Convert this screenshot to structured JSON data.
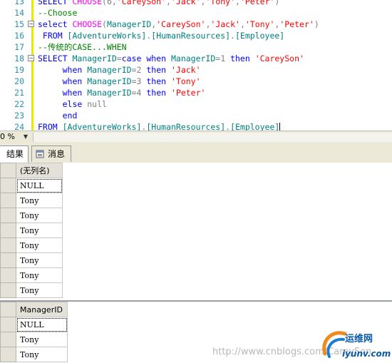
{
  "editor": {
    "lines": [
      {
        "num": "13",
        "parts": [
          [
            "kw",
            "SELECT "
          ],
          [
            "fn",
            "CHOOSE"
          ],
          [
            "gr",
            "(6,"
          ],
          [
            "str",
            "'CareySon'"
          ],
          [
            "gr",
            ","
          ],
          [
            "str",
            "'Jack'"
          ],
          [
            "gr",
            ","
          ],
          [
            "str",
            "'Tony'"
          ],
          [
            "gr",
            ","
          ],
          [
            "str",
            "'Peter'"
          ],
          [
            "gr",
            ")"
          ]
        ]
      },
      {
        "num": "14",
        "parts": [
          [
            "cm",
            "--Choose"
          ]
        ]
      },
      {
        "num": "15",
        "fold": "−",
        "parts": [
          [
            "kw",
            "select "
          ],
          [
            "fn",
            "CHOOSE"
          ],
          [
            "gr",
            "("
          ],
          [
            "tx",
            "ManagerID"
          ],
          [
            "gr",
            ","
          ],
          [
            "str",
            "'CareySon'"
          ],
          [
            "gr",
            ","
          ],
          [
            "str",
            "'Jack'"
          ],
          [
            "gr",
            ","
          ],
          [
            "str",
            "'Tony'"
          ],
          [
            "gr",
            ","
          ],
          [
            "str",
            "'Peter'"
          ],
          [
            "gr",
            ")"
          ]
        ]
      },
      {
        "num": "16",
        "parts": [
          [
            "kw",
            " FROM "
          ],
          [
            "tx",
            "[AdventureWorks]"
          ],
          [
            "gr",
            "."
          ],
          [
            "tx",
            "[HumanResources]"
          ],
          [
            "gr",
            "."
          ],
          [
            "tx",
            "[Employee]"
          ]
        ]
      },
      {
        "num": "17",
        "parts": [
          [
            "cm",
            "--传统的CASE...WHEN"
          ]
        ]
      },
      {
        "num": "18",
        "fold": "−",
        "parts": [
          [
            "kw",
            "SELECT "
          ],
          [
            "tx",
            "ManagerID"
          ],
          [
            "gr",
            "="
          ],
          [
            "kw",
            "case when "
          ],
          [
            "tx",
            "ManagerID"
          ],
          [
            "gr",
            "=1 "
          ],
          [
            "kw",
            "then "
          ],
          [
            "str",
            "'CareySon'"
          ]
        ]
      },
      {
        "num": "19",
        "parts": [
          [
            "kw",
            "     when "
          ],
          [
            "tx",
            "ManagerID"
          ],
          [
            "gr",
            "=2 "
          ],
          [
            "kw",
            "then "
          ],
          [
            "str",
            "'Jack'"
          ]
        ]
      },
      {
        "num": "20",
        "parts": [
          [
            "kw",
            "     when "
          ],
          [
            "tx",
            "ManagerID"
          ],
          [
            "gr",
            "=3 "
          ],
          [
            "kw",
            "then "
          ],
          [
            "str",
            "'Tony'"
          ]
        ]
      },
      {
        "num": "21",
        "parts": [
          [
            "kw",
            "     when "
          ],
          [
            "tx",
            "ManagerID"
          ],
          [
            "gr",
            "=4 "
          ],
          [
            "kw",
            "then "
          ],
          [
            "str",
            "'Peter'"
          ]
        ]
      },
      {
        "num": "22",
        "parts": [
          [
            "kw",
            "     else "
          ],
          [
            "gr",
            "null"
          ]
        ]
      },
      {
        "num": "23",
        "parts": [
          [
            "kw",
            "     end"
          ]
        ]
      },
      {
        "num": "24",
        "caret": true,
        "parts": [
          [
            "kw",
            "FROM "
          ],
          [
            "tx",
            "[AdventureWorks]"
          ],
          [
            "gr",
            "."
          ],
          [
            "tx",
            "[HumanResources]"
          ],
          [
            "gr",
            "."
          ],
          [
            "tx",
            "[Employee]"
          ]
        ]
      }
    ]
  },
  "zoom": {
    "value": "0 %",
    "dropdown": "▼"
  },
  "tabs": {
    "results": "结果",
    "messages": "消息"
  },
  "grid1": {
    "column": "(无列名)",
    "rows": [
      "NULL",
      "Tony",
      "Tony",
      "Tony",
      "Tony",
      "Tony",
      "Tony",
      "Tony"
    ]
  },
  "grid2": {
    "column": "ManagerID",
    "rows": [
      "NULL",
      "Tony",
      "Tony"
    ]
  },
  "watermark": {
    "text": "http://www.cnblogs.com/CareySon",
    "logo_cn": "运维网",
    "logo_url": "iyunv.com"
  },
  "colors": {
    "keyword": "#0000ff",
    "function": "#ff00ff",
    "string": "#ff0000",
    "comment": "#008000",
    "identifier": "#008080"
  }
}
